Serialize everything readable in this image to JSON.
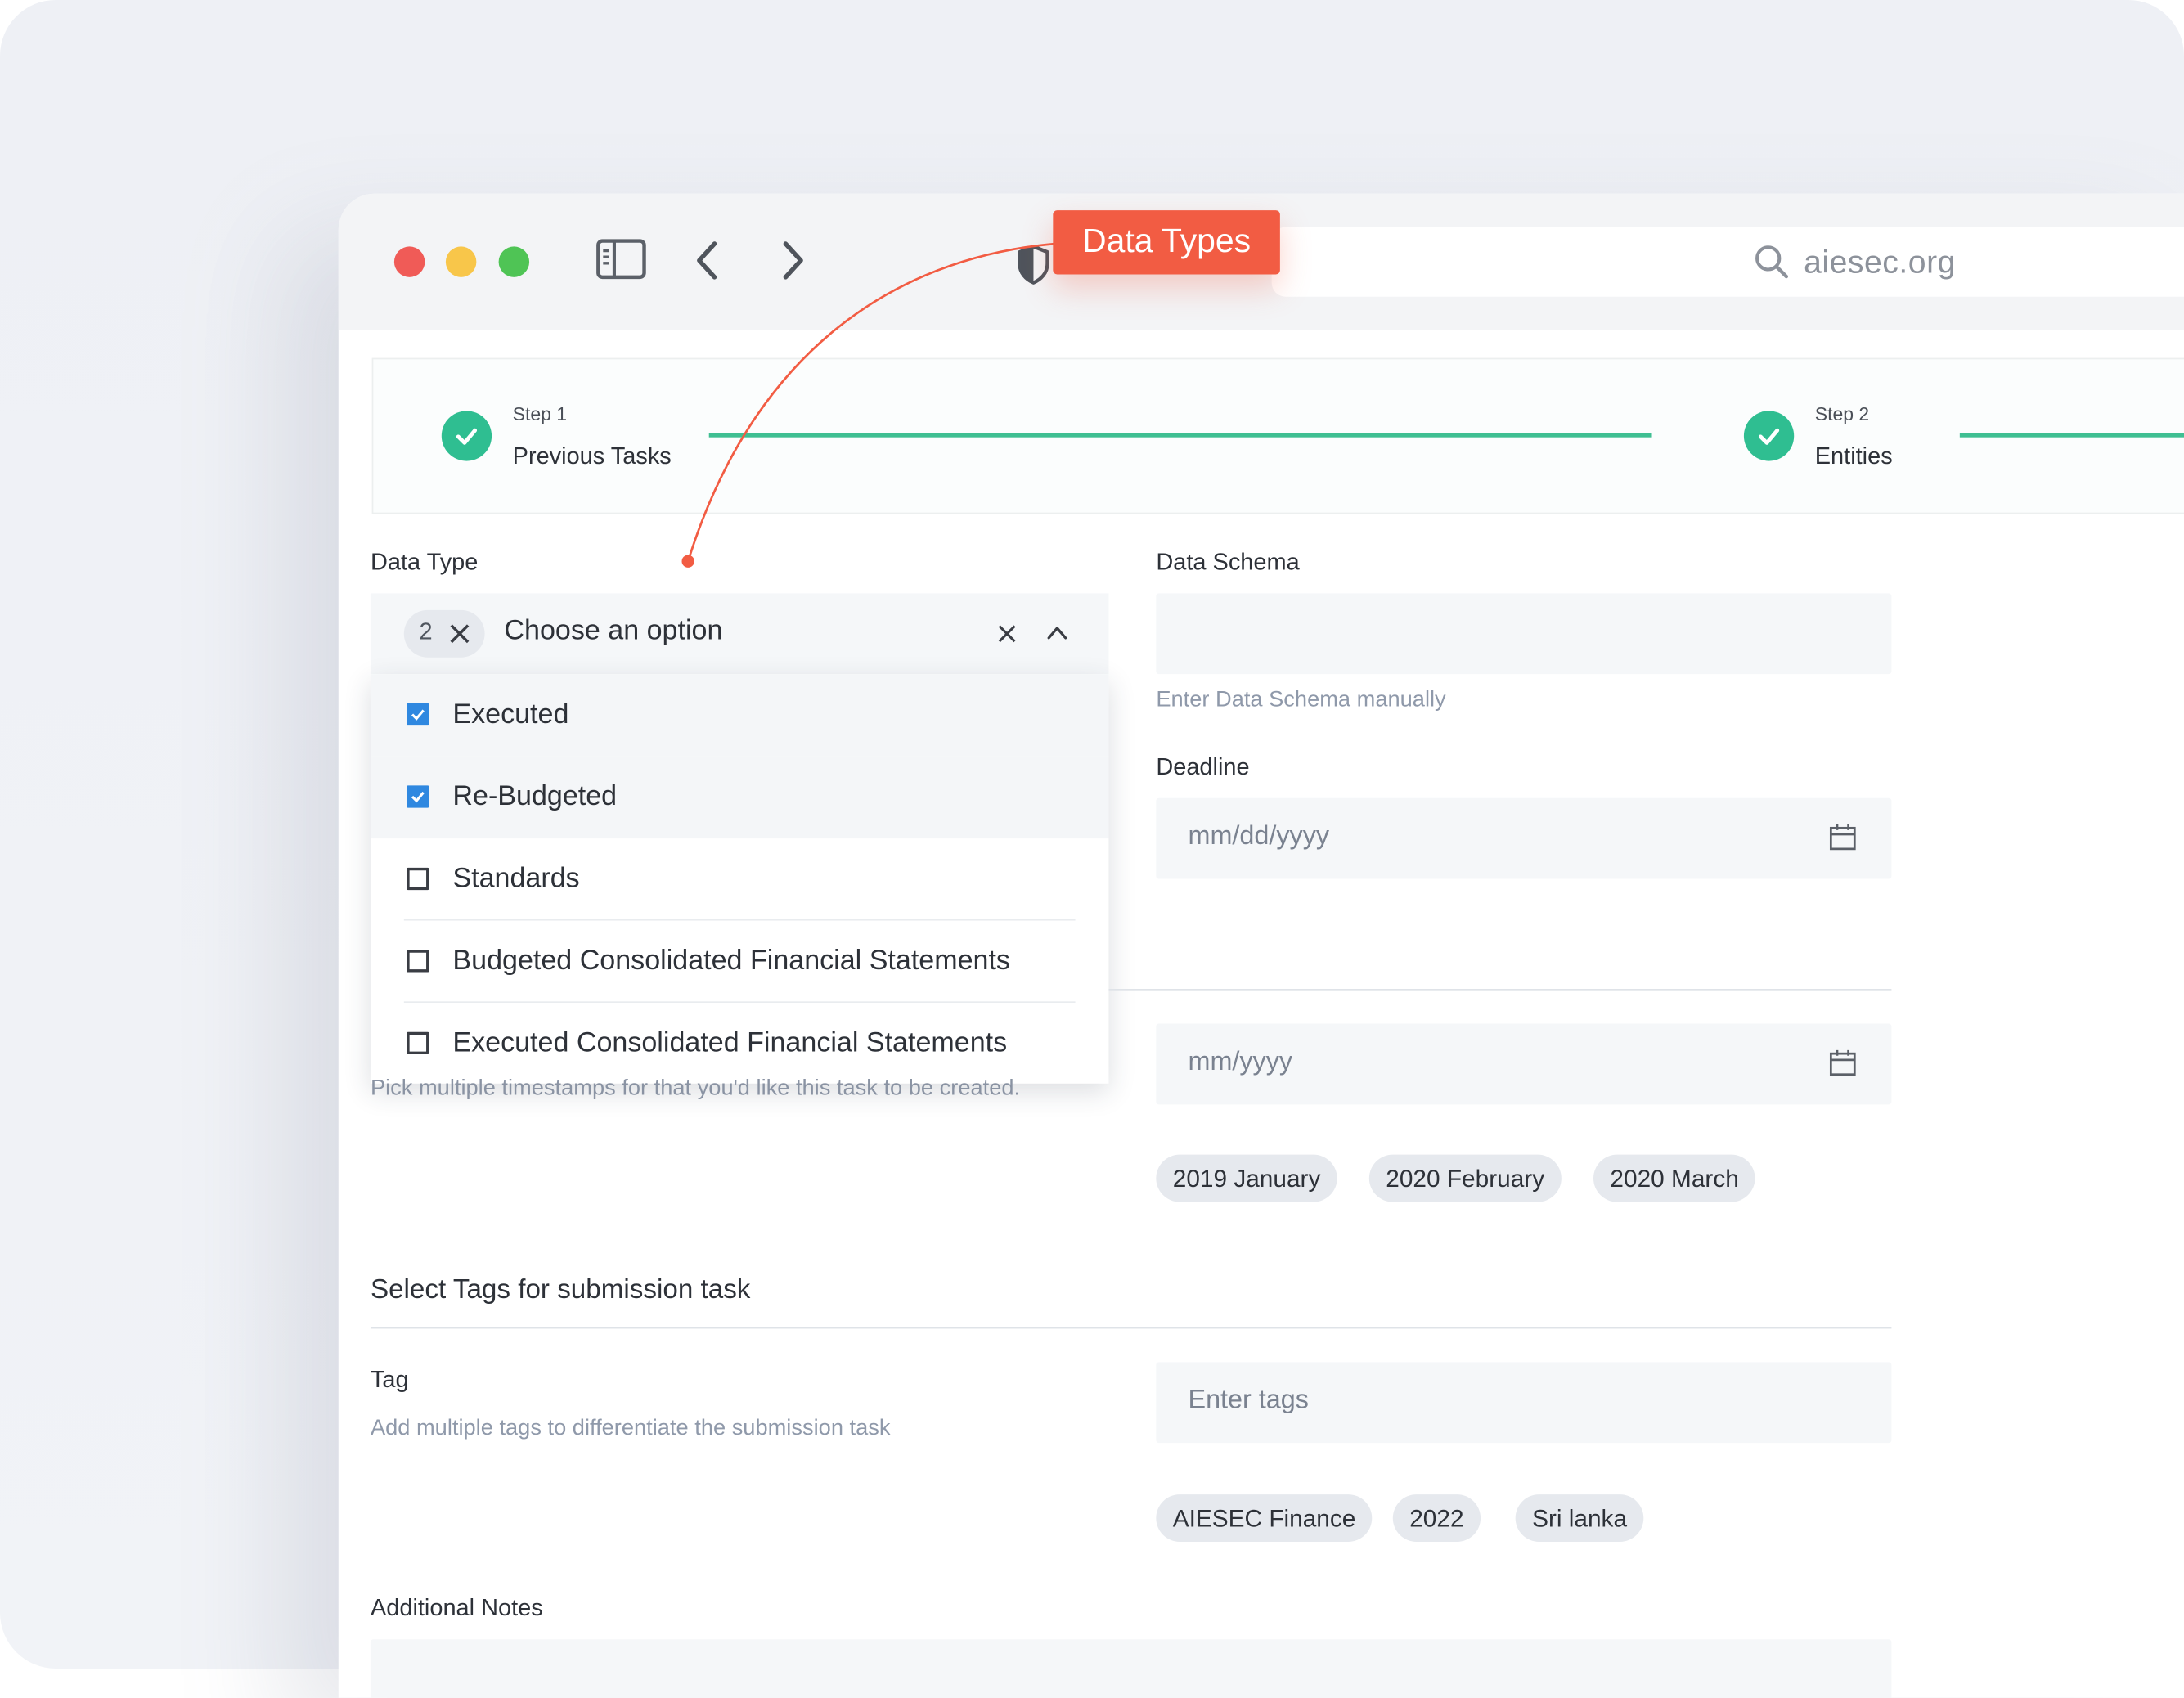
{
  "browser": {
    "url": "aiesec.org"
  },
  "annotation": {
    "label": "Data Types",
    "color": "#f25c43"
  },
  "stepper": {
    "steps": [
      {
        "number": "Step 1",
        "name": "Previous Tasks",
        "status": "completed"
      },
      {
        "number": "Step 2",
        "name": "Entities",
        "status": "completed"
      }
    ],
    "accent": "#2fbe91"
  },
  "form": {
    "data_type": {
      "label": "Data Type",
      "selected_count": "2",
      "placeholder": "Choose an option",
      "options": [
        {
          "label": "Executed",
          "checked": true
        },
        {
          "label": "Re-Budgeted",
          "checked": true
        },
        {
          "label": "Standards",
          "checked": false
        },
        {
          "label": "Budgeted Consolidated Financial Statements",
          "checked": false
        },
        {
          "label": "Executed Consolidated Financial Statements",
          "checked": false
        }
      ],
      "checkbox_color": "#2f88e0"
    },
    "data_schema": {
      "label": "Data Schema",
      "value": "",
      "hint": "Enter Data Schema manually"
    },
    "deadline": {
      "label": "Deadline",
      "placeholder": "mm/dd/yyyy"
    },
    "timestamps": {
      "hint": "Pick multiple timestamps for that you'd like this task to be created.",
      "placeholder": "mm/yyyy",
      "chips": [
        "2019 January",
        "2020 February",
        "2020 March"
      ]
    },
    "tags_section": {
      "title": "Select Tags for submission task",
      "tag_label": "Tag",
      "tag_hint": "Add multiple tags to differentiate the submission task",
      "placeholder": "Enter tags",
      "chips": [
        "AIESEC Finance",
        "2022",
        "Sri lanka"
      ]
    },
    "notes": {
      "label": "Additional Notes"
    }
  }
}
